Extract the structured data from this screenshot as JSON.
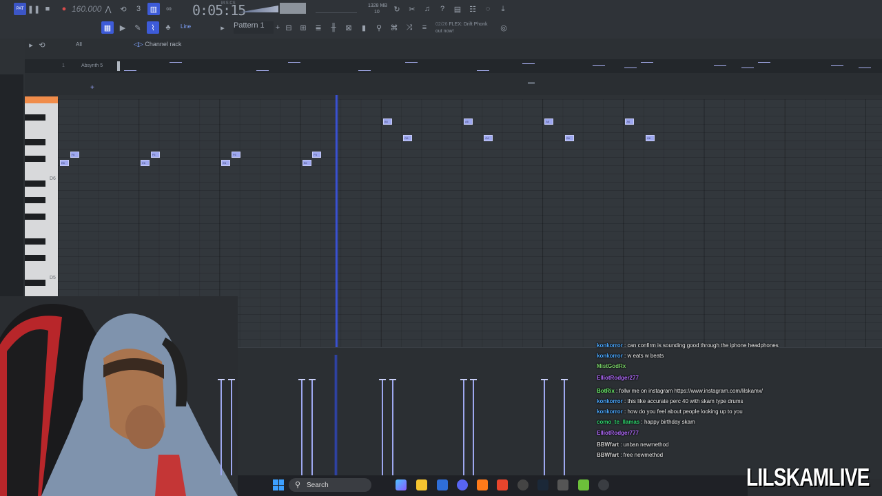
{
  "toolbar": {
    "tempo": "160.000",
    "time": "0:05:15",
    "time_sub": "M:S:CS",
    "memory": "1328 MB",
    "memory_sub": "10",
    "pattern": "Pattern 1",
    "snap": "Line",
    "news_date": "02/26",
    "news_title": "FLEX: Drift Phonk",
    "news_sub": "out now!"
  },
  "channel_rack": {
    "filter": "All",
    "title": "Channel rack",
    "channel_number": "1",
    "channel_name": "Absynth 5"
  },
  "piano_roll": {
    "octave_labels": [
      "D6",
      "D5"
    ],
    "notes": [
      {
        "label": "F6",
        "beat": 0.5
      },
      {
        "label": "E6",
        "beat": 0.0
      },
      {
        "label": "F6",
        "beat": 4.5
      },
      {
        "label": "E6",
        "beat": 4.0
      },
      {
        "label": "F6",
        "beat": 8.5
      },
      {
        "label": "E6",
        "beat": 8.0
      },
      {
        "label": "F6",
        "beat": 12.5
      },
      {
        "label": "E6",
        "beat": 12.0
      },
      {
        "label": "A6",
        "beat": 16.0
      },
      {
        "label": "G6",
        "beat": 17.0
      },
      {
        "label": "A6",
        "beat": 20.0
      },
      {
        "label": "G6",
        "beat": 21.0
      },
      {
        "label": "A6",
        "beat": 24.0
      },
      {
        "label": "G6",
        "beat": 25.0
      },
      {
        "label": "A6",
        "beat": 28.0
      },
      {
        "label": "G6",
        "beat": 29.0
      }
    ]
  },
  "chat": {
    "messages": [
      {
        "user": "konkorror",
        "text": "can confirm is sounding good through the iphone headphones",
        "color": "#4aa8ff"
      },
      {
        "user": "konkorror",
        "text": "w eats w beats",
        "color": "#4aa8ff"
      },
      {
        "user": "MistGodRx",
        "text": "",
        "color": "#7bd26a"
      },
      {
        "user": "ElliotRodger277",
        "text": "",
        "color": "#b36bff"
      },
      {
        "user": "BotRix",
        "text": "follw me on instagram https://www.instagram.com/lilskamx/",
        "color": "#6cf06c"
      },
      {
        "user": "konkorror",
        "text": "this like accurate perc 40 with skam type drums",
        "color": "#4aa8ff"
      },
      {
        "user": "konkorror",
        "text": "how do you feel about people looking up to you",
        "color": "#4aa8ff"
      },
      {
        "user": "como_te_llamas",
        "text": "happy birthday skam",
        "color": "#2fd66e"
      },
      {
        "user": "ElliotRodger777",
        "text": "",
        "color": "#b36bff"
      },
      {
        "user": "BBWfart",
        "text": "unban newmethod",
        "color": "#d4d4d4"
      },
      {
        "user": "BBWfart",
        "text": "free newmethod",
        "color": "#d4d4d4"
      }
    ]
  },
  "taskbar": {
    "search_label": "Search"
  },
  "watermark": "LILSKAMLIVE",
  "colors": {
    "accent": "#3d5bd8",
    "note": "#9ea8f0",
    "playhead": "#3b55e6"
  }
}
